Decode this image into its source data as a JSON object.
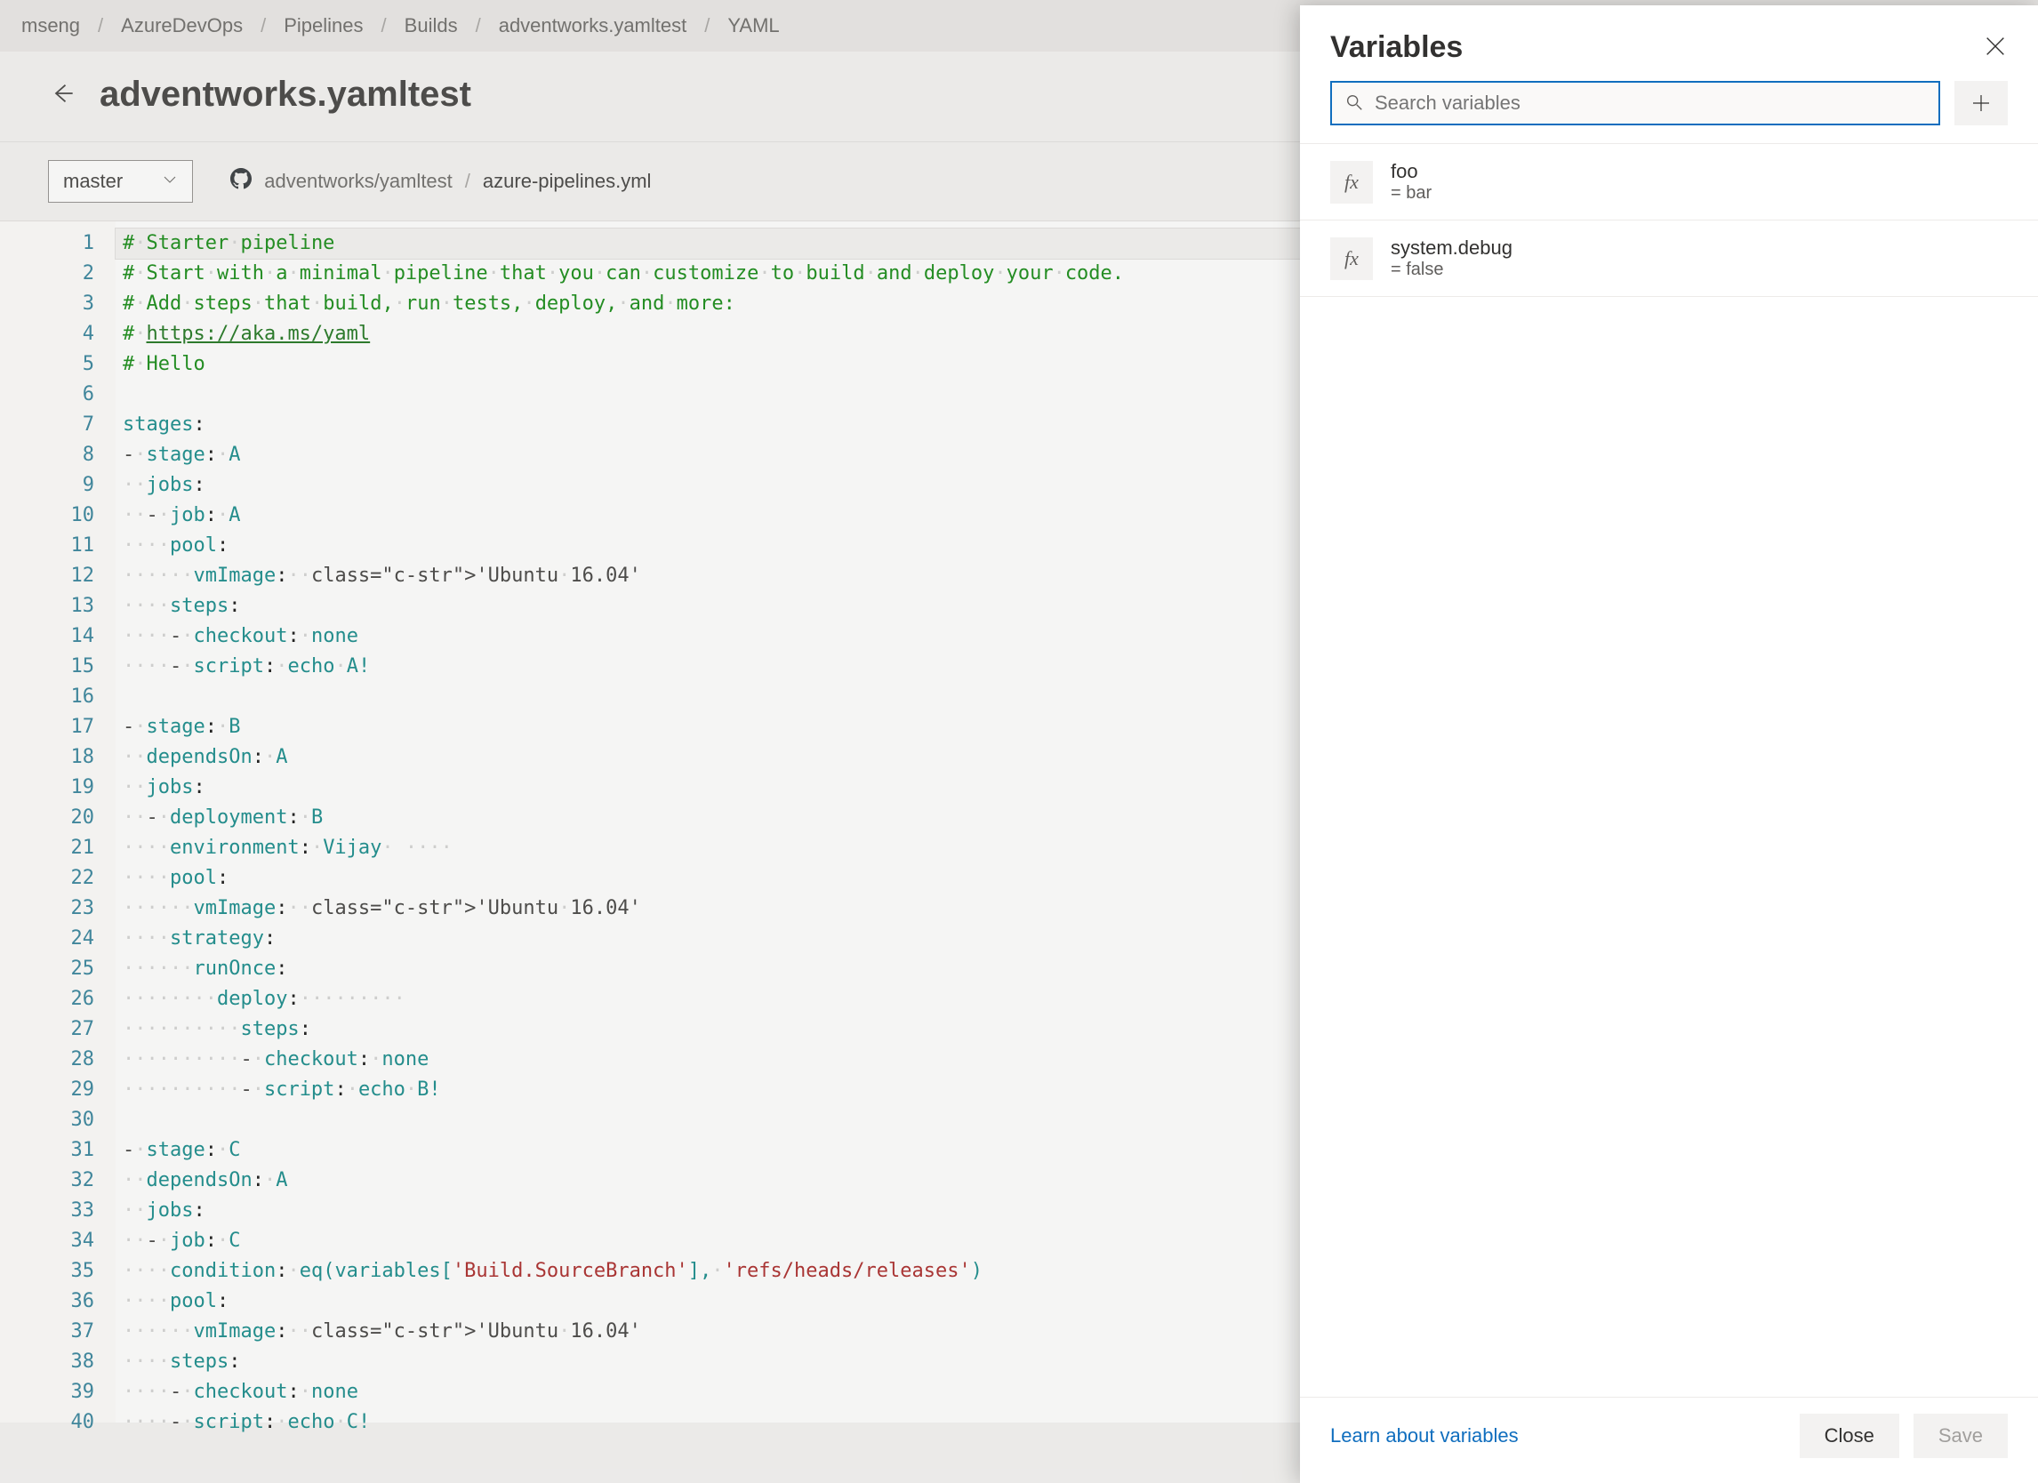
{
  "breadcrumb": [
    "mseng",
    "AzureDevOps",
    "Pipelines",
    "Builds",
    "adventworks.yamltest",
    "YAML"
  ],
  "page_title": "adventworks.yamltest",
  "branch": "master",
  "repo_path": {
    "repo": "adventworks/yamltest",
    "file": "azure-pipelines.yml"
  },
  "code_lines": [
    {
      "n": 1,
      "t": "comment",
      "text": "# Starter pipeline"
    },
    {
      "n": 2,
      "t": "comment",
      "text": "# Start with a minimal pipeline that you can customize to build and deploy your code."
    },
    {
      "n": 3,
      "t": "comment",
      "text": "# Add steps that build, run tests, deploy, and more:"
    },
    {
      "n": 4,
      "t": "commentlink",
      "prefix": "# ",
      "link": "https://aka.ms/yaml"
    },
    {
      "n": 5,
      "t": "comment",
      "text": "# Hello"
    },
    {
      "n": 6,
      "t": "blank"
    },
    {
      "n": 7,
      "t": "kv",
      "indent": 0,
      "dashed": false,
      "key": "stages",
      "val": ""
    },
    {
      "n": 8,
      "t": "kv",
      "indent": 0,
      "dashed": true,
      "key": "stage",
      "val": " A"
    },
    {
      "n": 9,
      "t": "kv",
      "indent": 1,
      "dashed": false,
      "key": "jobs",
      "val": ""
    },
    {
      "n": 10,
      "t": "kv",
      "indent": 1,
      "dashed": true,
      "key": "job",
      "val": " A"
    },
    {
      "n": 11,
      "t": "kv",
      "indent": 2,
      "dashed": false,
      "key": "pool",
      "val": ""
    },
    {
      "n": 12,
      "t": "kv",
      "indent": 3,
      "dashed": false,
      "key": "vmImage",
      "val": " 'Ubuntu 16.04'"
    },
    {
      "n": 13,
      "t": "kv",
      "indent": 2,
      "dashed": false,
      "key": "steps",
      "val": ""
    },
    {
      "n": 14,
      "t": "kv",
      "indent": 2,
      "dashed": true,
      "key": "checkout",
      "val": " none"
    },
    {
      "n": 15,
      "t": "kv",
      "indent": 2,
      "dashed": true,
      "key": "script",
      "val": " echo A!"
    },
    {
      "n": 16,
      "t": "blank"
    },
    {
      "n": 17,
      "t": "kv",
      "indent": 0,
      "dashed": true,
      "key": "stage",
      "val": " B"
    },
    {
      "n": 18,
      "t": "kv",
      "indent": 1,
      "dashed": false,
      "key": "dependsOn",
      "val": " A"
    },
    {
      "n": 19,
      "t": "kv",
      "indent": 1,
      "dashed": false,
      "key": "jobs",
      "val": ""
    },
    {
      "n": 20,
      "t": "kv",
      "indent": 1,
      "dashed": true,
      "key": "deployment",
      "val": " B"
    },
    {
      "n": 21,
      "t": "kv",
      "indent": 2,
      "dashed": false,
      "key": "environment",
      "val": " Vijay   ",
      "trailws": 3
    },
    {
      "n": 22,
      "t": "kv",
      "indent": 2,
      "dashed": false,
      "key": "pool",
      "val": ""
    },
    {
      "n": 23,
      "t": "kv",
      "indent": 3,
      "dashed": false,
      "key": "vmImage",
      "val": " 'Ubuntu 16.04'"
    },
    {
      "n": 24,
      "t": "kv",
      "indent": 2,
      "dashed": false,
      "key": "strategy",
      "val": ""
    },
    {
      "n": 25,
      "t": "kv",
      "indent": 3,
      "dashed": false,
      "key": "runOnce",
      "val": ""
    },
    {
      "n": 26,
      "t": "kv",
      "indent": 4,
      "dashed": false,
      "key": "deploy",
      "val": "",
      "trailws": 9
    },
    {
      "n": 27,
      "t": "kv",
      "indent": 5,
      "dashed": false,
      "key": "steps",
      "val": ""
    },
    {
      "n": 28,
      "t": "kv",
      "indent": 5,
      "dashed": true,
      "key": "checkout",
      "val": " none"
    },
    {
      "n": 29,
      "t": "kv",
      "indent": 5,
      "dashed": true,
      "key": "script",
      "val": " echo B!"
    },
    {
      "n": 30,
      "t": "blank"
    },
    {
      "n": 31,
      "t": "kv",
      "indent": 0,
      "dashed": true,
      "key": "stage",
      "val": " C"
    },
    {
      "n": 32,
      "t": "kv",
      "indent": 1,
      "dashed": false,
      "key": "dependsOn",
      "val": " A"
    },
    {
      "n": 33,
      "t": "kv",
      "indent": 1,
      "dashed": false,
      "key": "jobs",
      "val": ""
    },
    {
      "n": 34,
      "t": "kv",
      "indent": 1,
      "dashed": true,
      "key": "job",
      "val": " C"
    },
    {
      "n": 35,
      "t": "kv",
      "indent": 2,
      "dashed": false,
      "key": "condition",
      "val": " eq(variables['Build.SourceBranch'], 'refs/heads/releases')"
    },
    {
      "n": 36,
      "t": "kv",
      "indent": 2,
      "dashed": false,
      "key": "pool",
      "val": ""
    },
    {
      "n": 37,
      "t": "kv",
      "indent": 3,
      "dashed": false,
      "key": "vmImage",
      "val": " 'Ubuntu 16.04'"
    },
    {
      "n": 38,
      "t": "kv",
      "indent": 2,
      "dashed": false,
      "key": "steps",
      "val": ""
    },
    {
      "n": 39,
      "t": "kv",
      "indent": 2,
      "dashed": true,
      "key": "checkout",
      "val": " none"
    },
    {
      "n": 40,
      "t": "kv",
      "indent": 2,
      "dashed": true,
      "key": "script",
      "val": " echo C!"
    }
  ],
  "panel": {
    "title": "Variables",
    "search_placeholder": "Search variables",
    "variables": [
      {
        "name": "foo",
        "value": "= bar"
      },
      {
        "name": "system.debug",
        "value": "= false"
      }
    ],
    "learn_link": "Learn about variables",
    "close_label": "Close",
    "save_label": "Save"
  }
}
